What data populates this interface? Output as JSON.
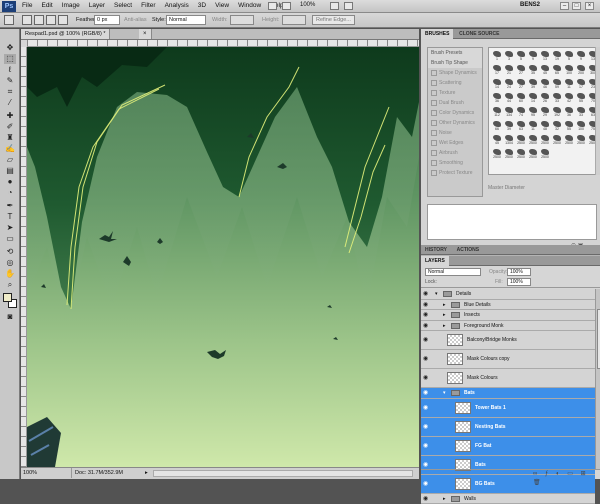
{
  "app": {
    "logo": "Ps",
    "menus": [
      "File",
      "Edit",
      "Image",
      "Layer",
      "Select",
      "Filter",
      "Analysis",
      "3D",
      "View",
      "Window",
      "Help"
    ],
    "zoom": "100%",
    "workspace": "BENS2"
  },
  "options": {
    "feather_label": "Feather:",
    "feather_value": "0 px",
    "antialias_label": "Anti-alias",
    "style_label": "Style:",
    "style_value": "Normal",
    "width_label": "Width:",
    "height_label": "Height:",
    "refine_edge": "Refine Edge..."
  },
  "document": {
    "tab_title": "Respad1.psd @ 100% (RGB/8) *",
    "close": "×"
  },
  "status": {
    "zoom": "100%",
    "doc": "Doc: 31.7M/352.9M"
  },
  "brushes_panel": {
    "tabs": [
      "BRUSHES",
      "CLONE SOURCE"
    ],
    "options": [
      "Brush Presets",
      "Brush Tip Shape",
      "Shape Dynamics",
      "Scattering",
      "Texture",
      "Dual Brush",
      "Color Dynamics",
      "Other Dynamics",
      "Noise",
      "Wet Edges",
      "Airbrush",
      "Smoothing",
      "Protect Texture"
    ],
    "diameter_label": "Master Diameter",
    "brush_sizes": [
      "1",
      "3",
      "5",
      "9",
      "13",
      "19",
      "5",
      "9",
      "13",
      "17",
      "21",
      "27",
      "35",
      "45",
      "65",
      "100",
      "200",
      "300",
      "14",
      "24",
      "27",
      "39",
      "46",
      "59",
      "11",
      "17",
      "23",
      "36",
      "44",
      "60",
      "14",
      "26",
      "33",
      "42",
      "55",
      "70",
      "112",
      "134",
      "74",
      "95",
      "29",
      "192",
      "36",
      "33",
      "63",
      "66",
      "39",
      "63",
      "11",
      "48",
      "32",
      "55",
      "100",
      "75",
      "45",
      "1304",
      "2500",
      "2500",
      "2500",
      "2500",
      "2500",
      "2500",
      "2500",
      "2500",
      "2500",
      "2500",
      "2500",
      "2500"
    ]
  },
  "history_tabs": [
    "HISTORY",
    "ACTIONS"
  ],
  "layers_panel": {
    "tabs": [
      "LAYERS"
    ],
    "blend_mode": "Normal",
    "opacity_label": "Opacity:",
    "opacity_value": "100%",
    "lock_label": "Lock:",
    "fill_label": "Fill:",
    "fill_value": "100%",
    "layers": [
      {
        "name": "Details",
        "type": "group",
        "depth": 0,
        "tall": false,
        "selected": false
      },
      {
        "name": "Blue Details",
        "type": "group",
        "depth": 1,
        "tall": false,
        "selected": false
      },
      {
        "name": "Insects",
        "type": "group",
        "depth": 1,
        "tall": false,
        "selected": false
      },
      {
        "name": "Foreground Monk",
        "type": "group",
        "depth": 1,
        "tall": false,
        "selected": false
      },
      {
        "name": "Balcony/Bridge Monks",
        "type": "layer",
        "depth": 1,
        "tall": true,
        "selected": false
      },
      {
        "name": "Mask Colours copy",
        "type": "layer",
        "depth": 1,
        "tall": true,
        "selected": false
      },
      {
        "name": "Mask Colours",
        "type": "layer",
        "depth": 1,
        "tall": true,
        "selected": false
      },
      {
        "name": "Bats",
        "type": "group",
        "depth": 1,
        "tall": false,
        "selected": true
      },
      {
        "name": "Tower Bats 1",
        "type": "layer",
        "depth": 2,
        "tall": true,
        "selected": true
      },
      {
        "name": "Nesting Bats",
        "type": "layer",
        "depth": 2,
        "tall": true,
        "selected": true
      },
      {
        "name": "FG Bat",
        "type": "layer",
        "depth": 2,
        "tall": true,
        "selected": true
      },
      {
        "name": "Bats",
        "type": "layer",
        "depth": 2,
        "tall": true,
        "selected": true
      },
      {
        "name": "BG Bats",
        "type": "layer",
        "depth": 2,
        "tall": true,
        "selected": true
      },
      {
        "name": "Walls",
        "type": "group",
        "depth": 1,
        "tall": false,
        "selected": false
      }
    ]
  },
  "colors": {
    "selection_blue": "#3d8fe9",
    "foreground_color": "#f0ecc8",
    "background_color": "#ffffff"
  }
}
